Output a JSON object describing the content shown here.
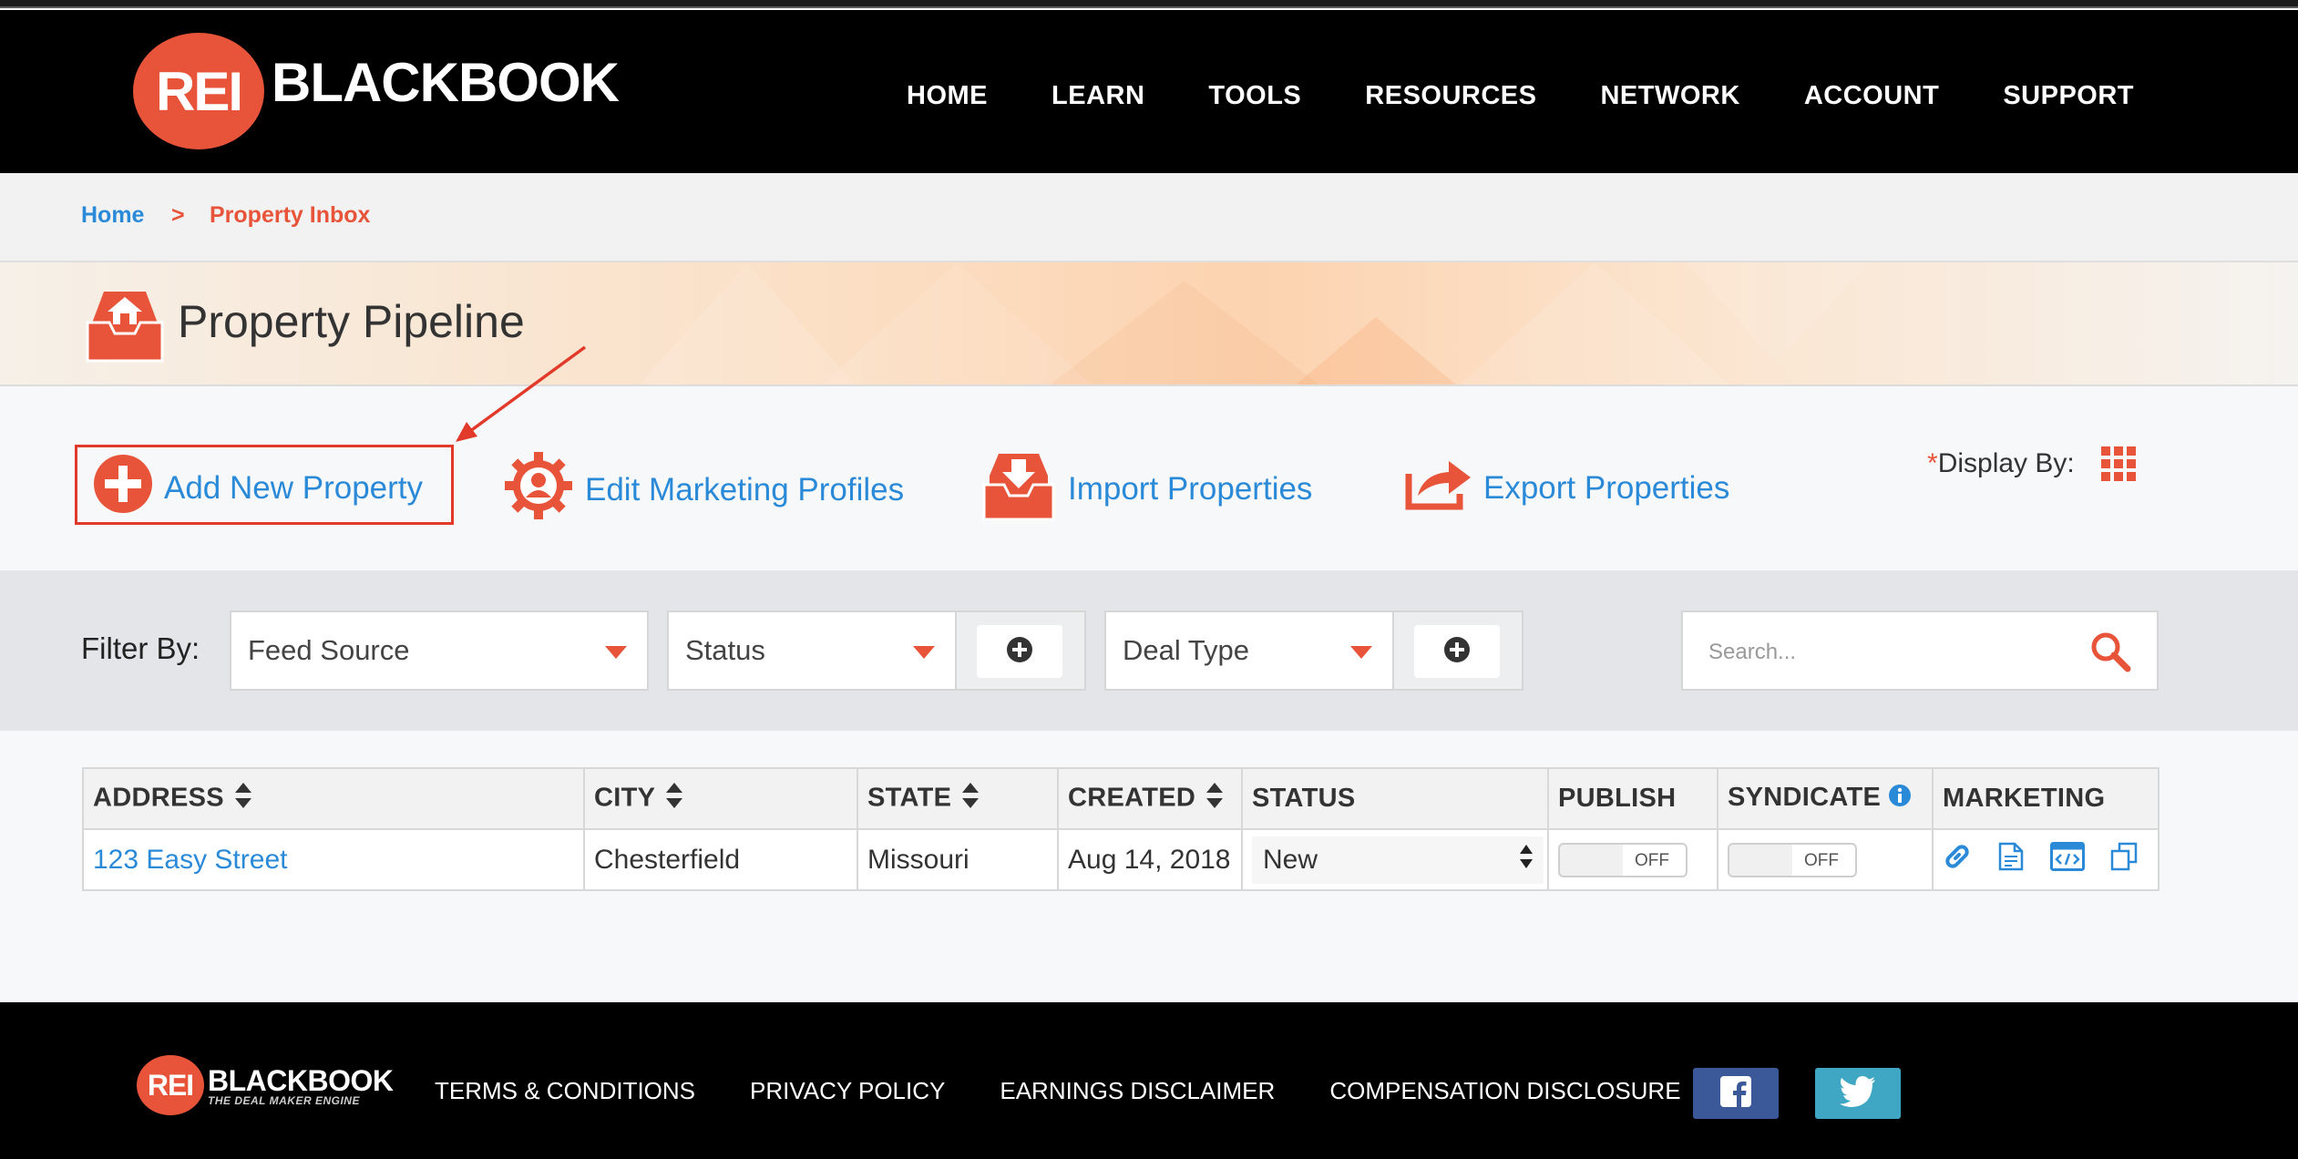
{
  "header": {
    "logo_mark": "REI",
    "logo_word": "BLACKBOOK",
    "nav": [
      "HOME",
      "LEARN",
      "TOOLS",
      "RESOURCES",
      "NETWORK",
      "ACCOUNT",
      "SUPPORT"
    ]
  },
  "breadcrumb": {
    "home": "Home",
    "separator": ">",
    "current": "Property Inbox"
  },
  "page": {
    "title": "Property Pipeline"
  },
  "actions": {
    "add": "Add New Property",
    "edit": "Edit Marketing Profiles",
    "import": "Import Properties",
    "export": "Export Properties",
    "display_star": "*",
    "display_by": "Display By:"
  },
  "filters": {
    "label": "Filter By:",
    "feed_source": "Feed Source",
    "status": "Status",
    "deal_type": "Deal Type",
    "search_placeholder": "Search..."
  },
  "table": {
    "headers": {
      "address": "ADDRESS",
      "city": "CITY",
      "state": "STATE",
      "created": "CREATED",
      "status": "STATUS",
      "publish": "PUBLISH",
      "syndicate": "SYNDICATE",
      "marketing": "MARKETING"
    },
    "rows": [
      {
        "address": "123 Easy Street",
        "city": "Chesterfield",
        "state": "Missouri",
        "created": "Aug 14, 2018",
        "status": "New",
        "publish": "OFF",
        "syndicate": "OFF"
      }
    ]
  },
  "footer": {
    "logo_mark": "REI",
    "logo_word": "BLACKBOOK",
    "tagline": "THE DEAL MAKER ENGINE",
    "links": [
      "TERMS & CONDITIONS",
      "PRIVACY POLICY",
      "EARNINGS DISCLAIMER",
      "COMPENSATION DISCLOSURE"
    ]
  },
  "colors": {
    "accent": "#e8543a",
    "link": "#2a8ad8",
    "facebook": "#3b5998",
    "twitter": "#3fa7c4"
  }
}
